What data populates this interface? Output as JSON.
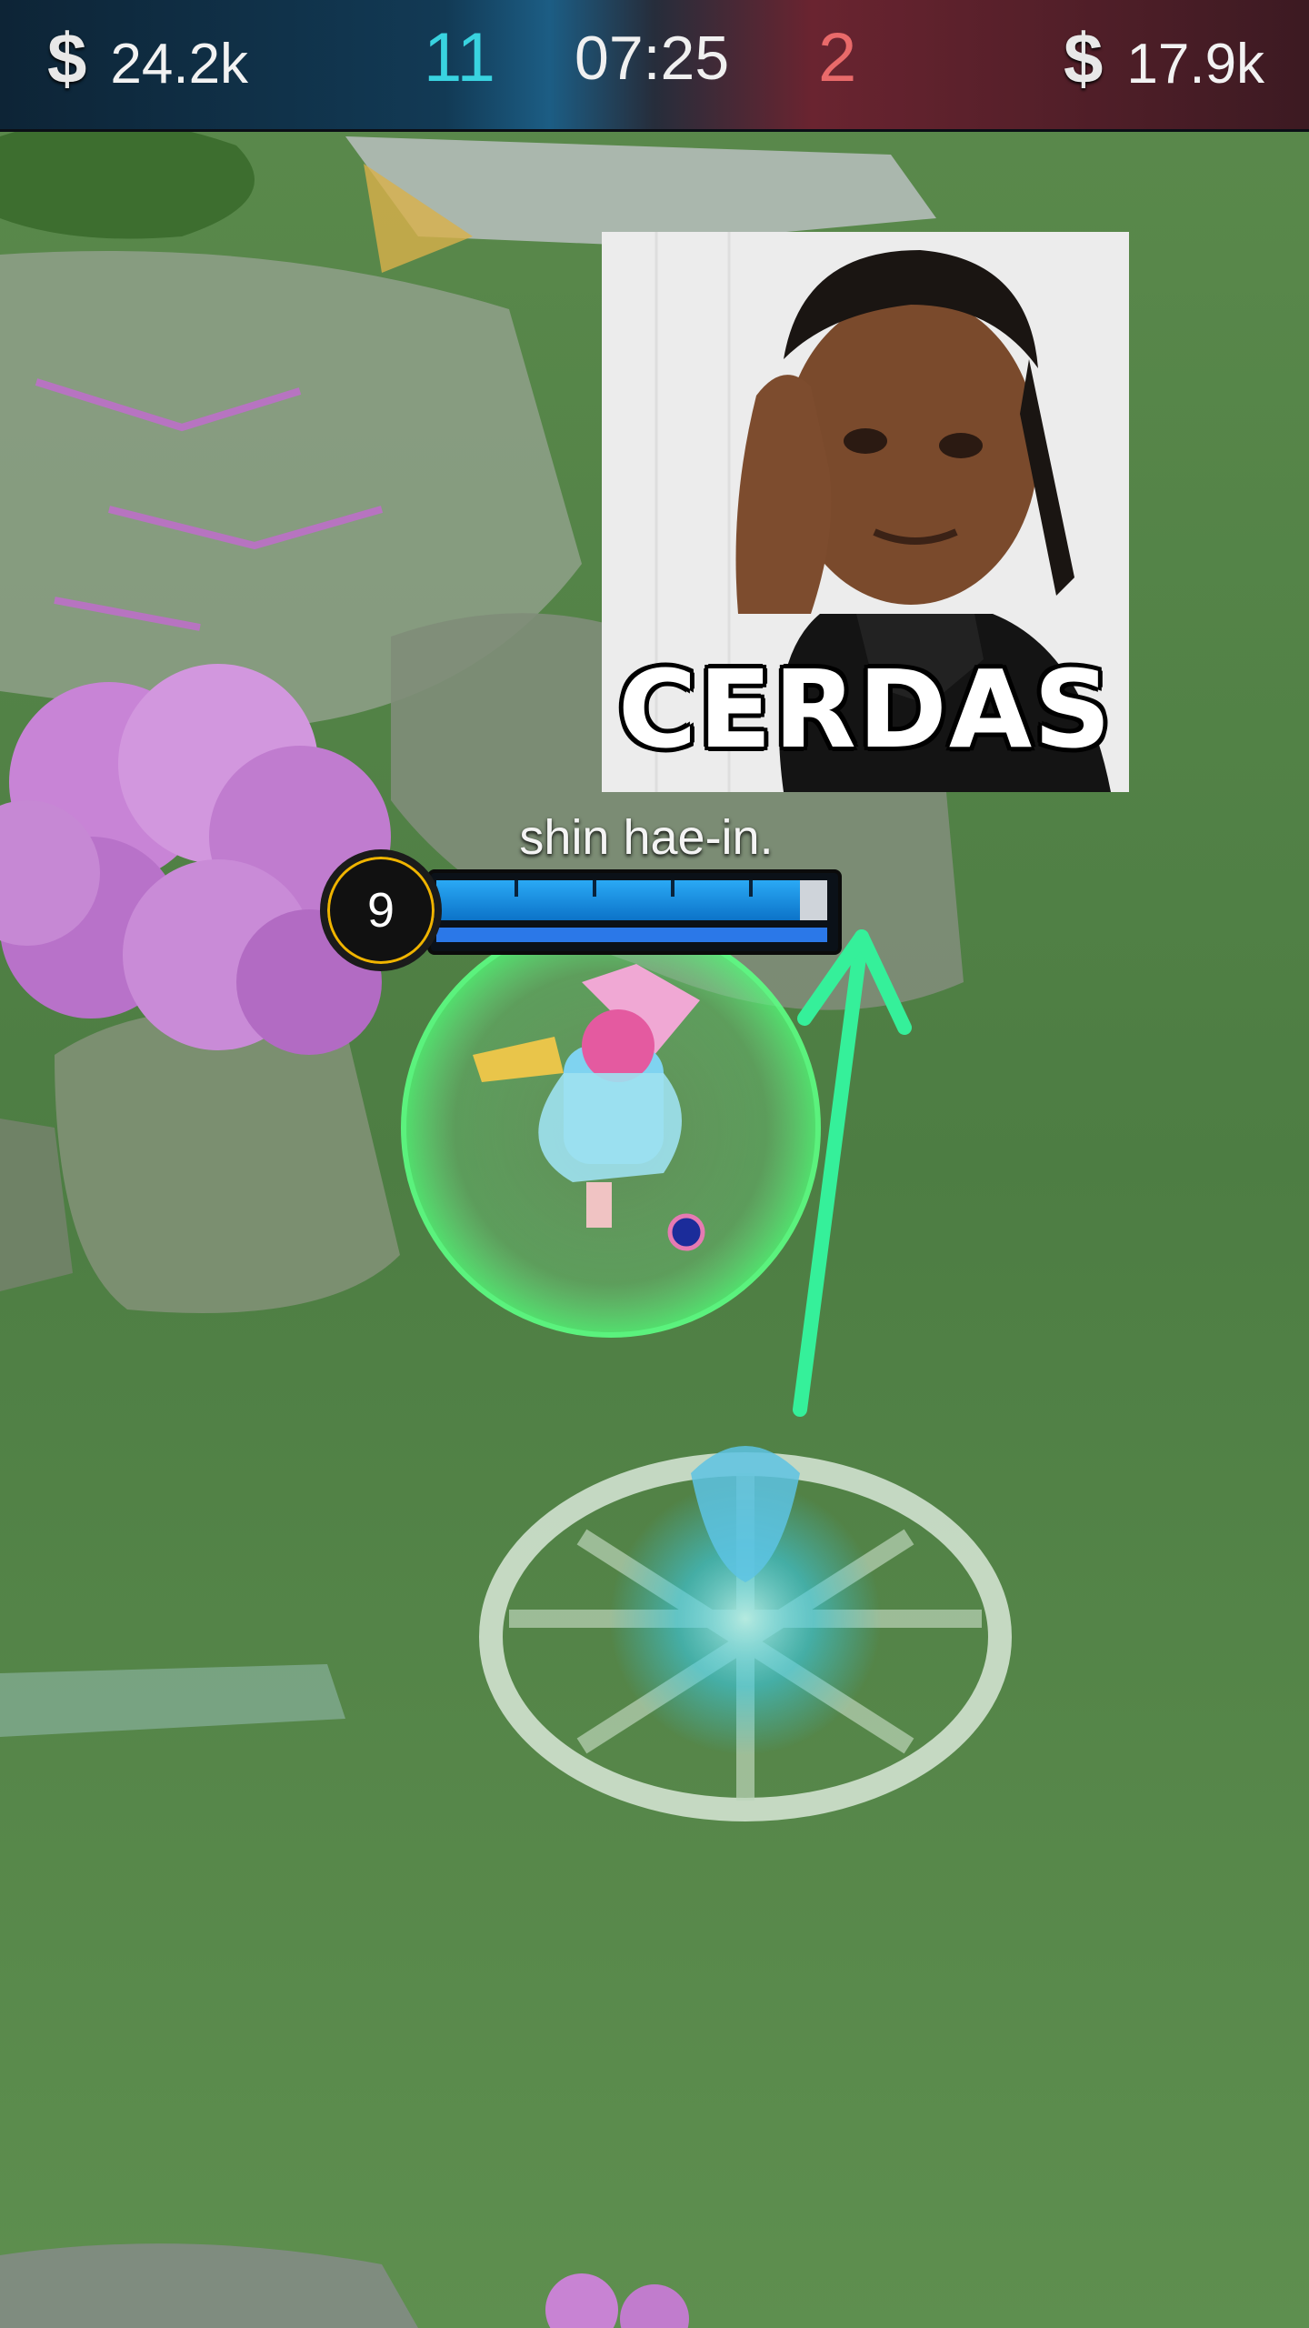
{
  "hud": {
    "gold_icon": "dollar-sign-icon",
    "blue_gold": "24.2k",
    "blue_kills": "11",
    "timer": "07:25",
    "red_kills": "2",
    "red_gold": "17.9k"
  },
  "meme_overlay": {
    "caption": "CERDAS"
  },
  "player": {
    "name": "shin hae-in.",
    "level": "9",
    "hp_fraction": 0.93,
    "mana_fraction": 1.0
  },
  "colors": {
    "blue_team": "#39d3e0",
    "red_team": "#e96a6a",
    "arrow": "#35f09a",
    "hp": "#2aa9f5",
    "level_ring": "#f0b400"
  }
}
